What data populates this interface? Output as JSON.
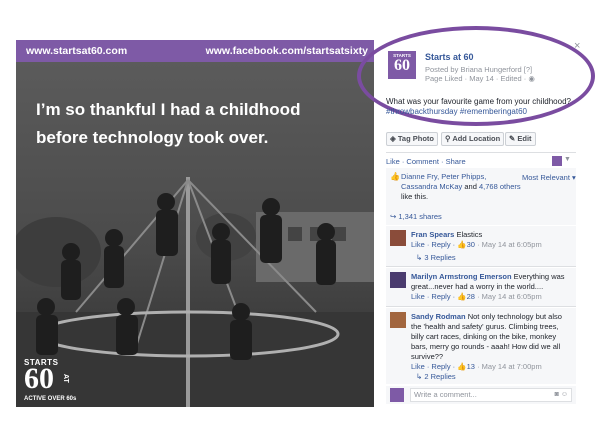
{
  "photo": {
    "url_left": "www.startsat60.com",
    "url_right": "www.facebook.com/startsatsixty",
    "quote": "I’m so thankful I had a childhood before technology took over.",
    "logo_starts": "STARTS",
    "logo_number": "60",
    "logo_at": "AT",
    "logo_tagline": "ACTIVE OVER 60s"
  },
  "post": {
    "close_label": "×",
    "avatar_starts": "STARTS",
    "avatar_number": "60",
    "page_name": "Starts at 60",
    "posted_by": "Posted by Briana Hungerford [?]",
    "meta": "Page Liked · May 14 · Edited ·",
    "text": "What was your favourite game from your childhood?",
    "tags": "#throwbackthursday #rememberingat60",
    "buttons": {
      "tag_photo": "Tag Photo",
      "add_location": "Add Location",
      "edit": "Edit"
    },
    "actions": "Like · Comment · Share",
    "likers_names": "Dianne Fry, Peter Phipps, Cassandra McKay",
    "likers_and": "and",
    "likers_others": "4,768 others",
    "likers_suffix": "like this.",
    "most_relevant": "Most Relevant ▾",
    "shares": "1,341 shares"
  },
  "comments": [
    {
      "name": "Fran Spears",
      "text": "Elastics",
      "actions": "Like · Reply ·",
      "likes": "30",
      "time": "May 14 at 6:05pm",
      "replies": "3 Replies",
      "avatar_color": "#8a4c3a"
    },
    {
      "name": "Marilyn Armstrong Emerson",
      "text": "Everything was great...never had a worry in the world....",
      "actions": "Like · Reply ·",
      "likes": "28",
      "time": "May 14 at 6:05pm",
      "avatar_color": "#4a3b6e"
    },
    {
      "name": "Sandy Rodman",
      "text": "Not only technology but also the 'health and safety' gurus. Climbing trees, billy cart races, dinking on the bike, monkey bars, merry go rounds - aaah! How did we all survive??",
      "actions": "Like · Reply ·",
      "likes": "13",
      "time": "May 14 at 7:00pm",
      "replies": "2 Replies",
      "avatar_color": "#a2663f"
    }
  ],
  "write_placeholder": "Write a comment...",
  "colors": {
    "brand_purple": "#7e5aa6",
    "highlight_oval": "#7a4ca0",
    "link_blue": "#365899"
  }
}
